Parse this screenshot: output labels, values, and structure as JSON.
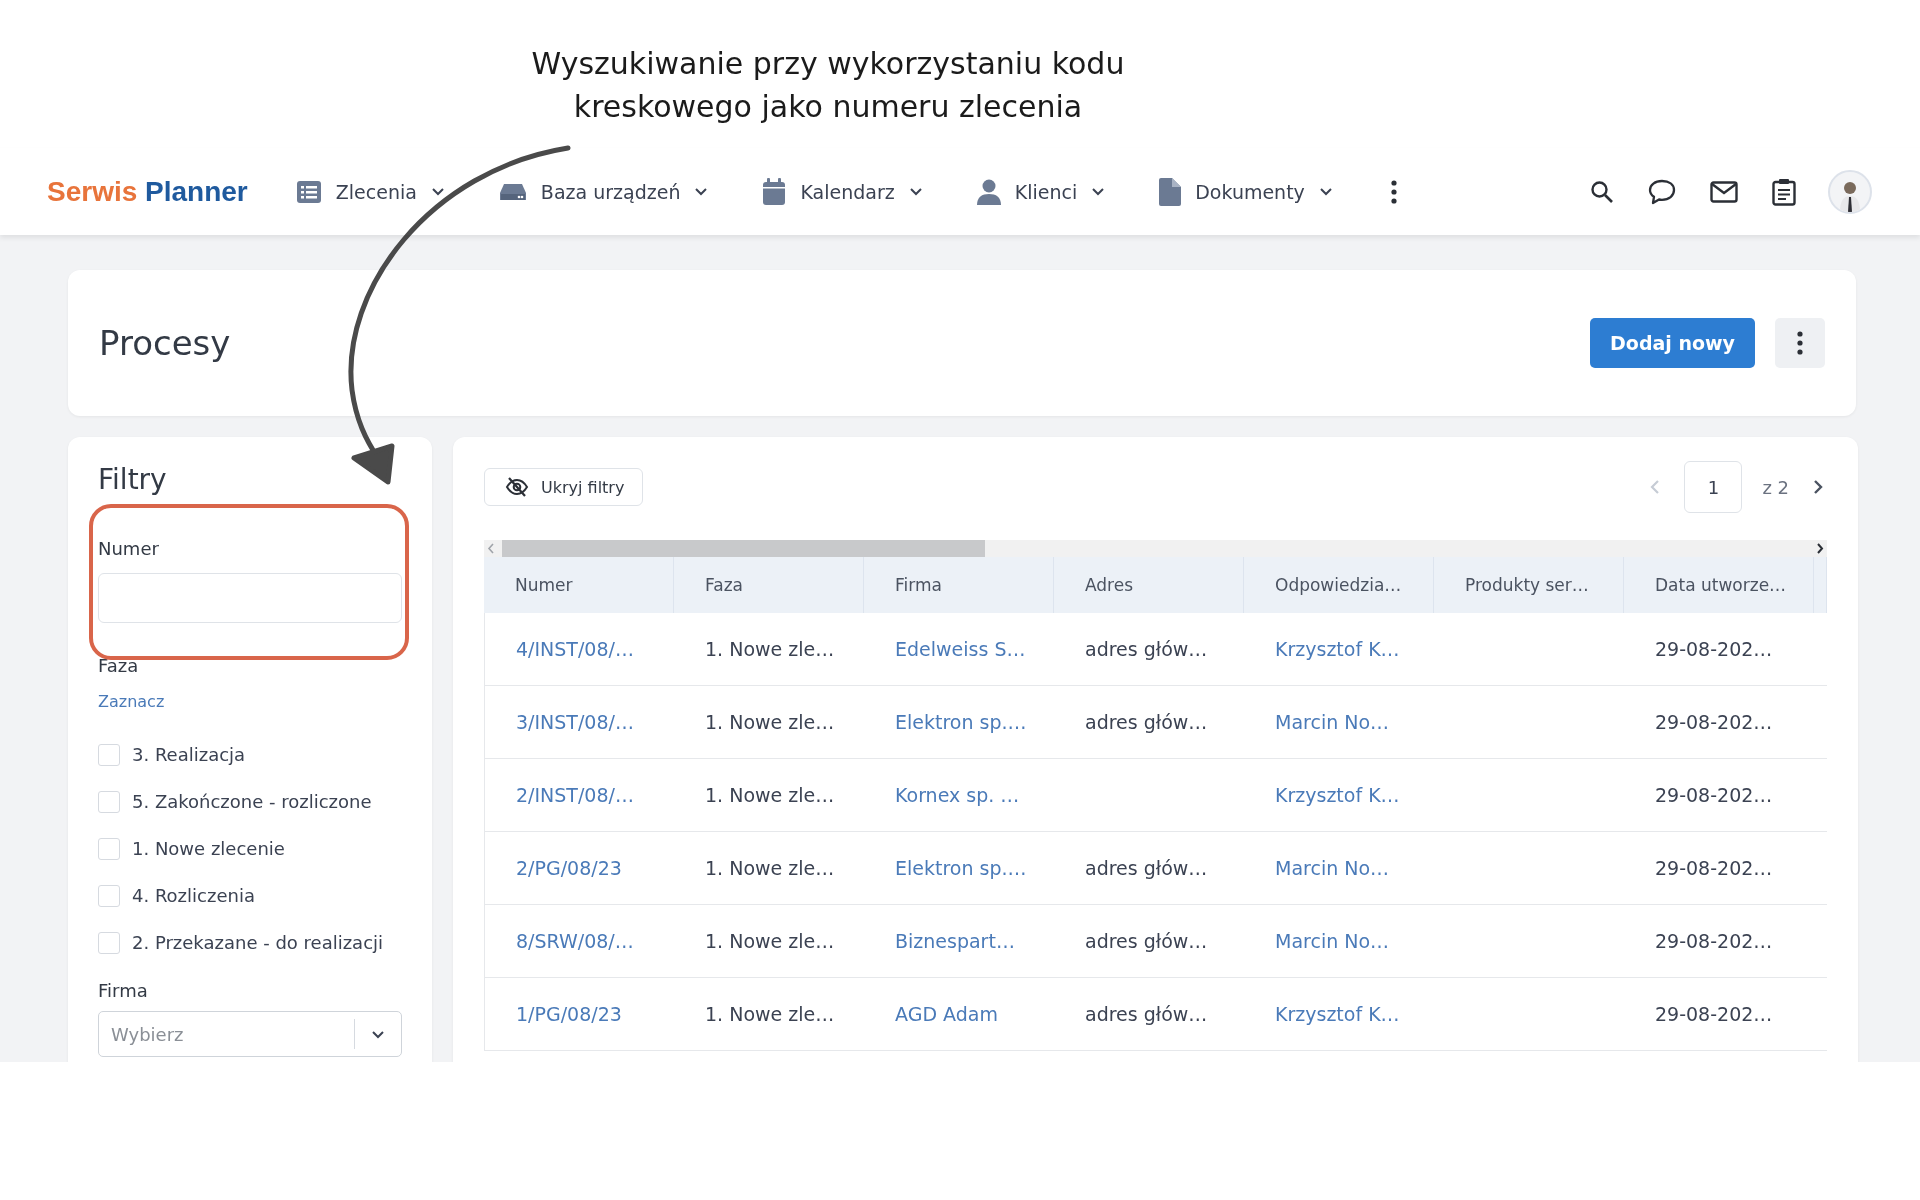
{
  "annotation": {
    "caption_lines": [
      "Wyszukiwanie przy wykorzystaniu kodu",
      "kreskowego jako numeru zlecenia"
    ]
  },
  "header": {
    "logo": [
      "Serwis",
      "Planner"
    ],
    "nav": [
      {
        "label": "Zlecenia"
      },
      {
        "label": "Baza urządzeń"
      },
      {
        "label": "Kalendarz"
      },
      {
        "label": "Klienci"
      },
      {
        "label": "Dokumenty"
      }
    ]
  },
  "page": {
    "title": "Procesy",
    "add_button": "Dodaj nowy"
  },
  "filters": {
    "title": "Filtry",
    "number_label": "Numer",
    "phase_label": "Faza",
    "select_link": "Zaznacz",
    "phases": [
      {
        "label": "3. Realizacja",
        "checked": false
      },
      {
        "label": "5. Zakończone - rozliczone",
        "checked": false
      },
      {
        "label": "1. Nowe zlecenie",
        "checked": false
      },
      {
        "label": "4. Rozliczenia",
        "checked": false
      },
      {
        "label": "2. Przekazane - do realizacji",
        "checked": false
      }
    ],
    "company_label": "Firma",
    "company_placeholder": "Wybierz"
  },
  "table": {
    "hide_filters": "Ukryj filtry",
    "pagination": {
      "page": "1",
      "of": "z 2",
      "prev_disabled": true
    },
    "columns": [
      {
        "label": "Numer",
        "kind": "link"
      },
      {
        "label": "Faza",
        "kind": "text"
      },
      {
        "label": "Firma",
        "kind": "link"
      },
      {
        "label": "Adres",
        "kind": "text"
      },
      {
        "label": "Odpowiedzia…",
        "kind": "link"
      },
      {
        "label": "Produkty ser…"
      },
      {
        "label": "Data utworze…",
        "kind": "text"
      }
    ],
    "rows": [
      [
        "4/INST/08/…",
        "1. Nowe zle…",
        "Edelweiss S…",
        "adres głów…",
        "Krzysztof K…",
        null,
        "29-08-202…"
      ],
      [
        "3/INST/08/…",
        "1. Nowe zle…",
        "Elektron sp.…",
        "adres głów…",
        "Marcin No…",
        null,
        "29-08-202…"
      ],
      [
        "2/INST/08/…",
        "1. Nowe zle…",
        "Kornex sp. …",
        null,
        "Krzysztof K…",
        null,
        "29-08-202…"
      ],
      [
        "2/PG/08/23",
        "1. Nowe zle…",
        "Elektron sp.…",
        "adres głów…",
        "Marcin No…",
        null,
        "29-08-202…"
      ],
      [
        "8/SRW/08/…",
        "1. Nowe zle…",
        "Biznespart…",
        "adres głów…",
        "Marcin No…",
        null,
        "29-08-202…"
      ],
      [
        "1/PG/08/23",
        "1. Nowe zle…",
        "AGD Adam",
        "adres głów…",
        "Krzysztof K…",
        null,
        "29-08-202…"
      ]
    ]
  }
}
